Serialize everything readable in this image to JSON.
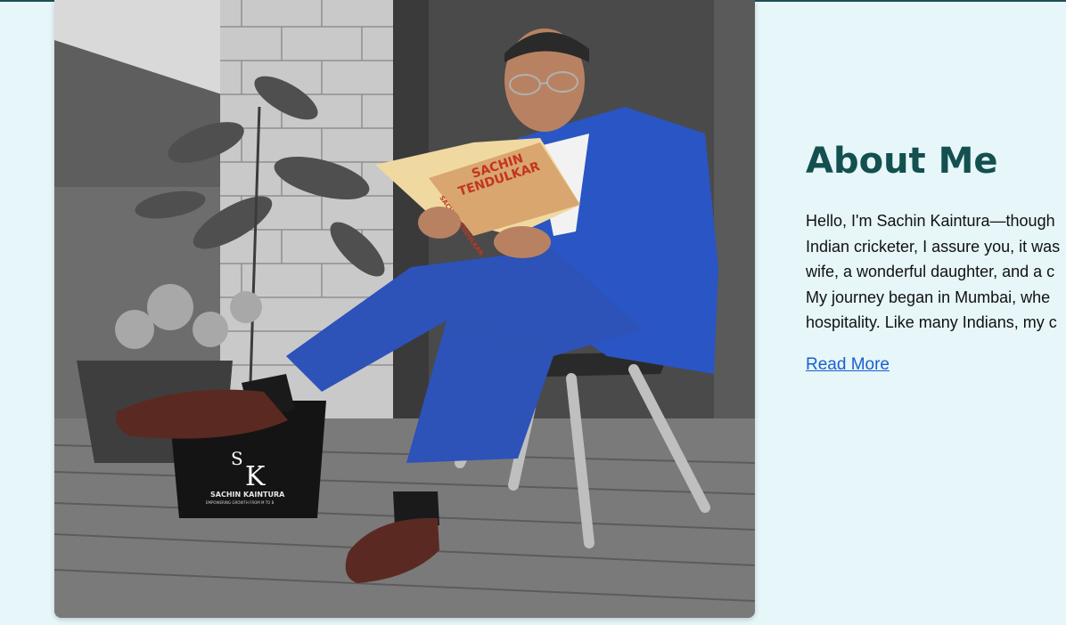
{
  "about": {
    "heading": "About Me",
    "bio_lines": [
      "Hello, I'm Sachin Kaintura—though",
      "Indian cricketer, I assure you, it was",
      "wife, a wonderful daughter, and a c",
      "My journey began in Mumbai, whe",
      "hospitality. Like many Indians, my c"
    ],
    "read_more_label": "Read More"
  },
  "photo": {
    "book_title_line1": "SACHIN",
    "book_title_line2": "TENDULKAR",
    "book_spine": "SACHIN TENDULKAR",
    "logo_letters_s": "S",
    "logo_letters_k": "K",
    "logo_name": "SACHIN KAINTURA",
    "logo_tagline": "EMPOWERING GROWTH FROM M TO B"
  },
  "colors": {
    "page_background": "#e6f6f9",
    "heading": "#13504f",
    "link": "#1a5fcf",
    "suit": "#2a55c4",
    "shoe": "#5a2a22"
  }
}
